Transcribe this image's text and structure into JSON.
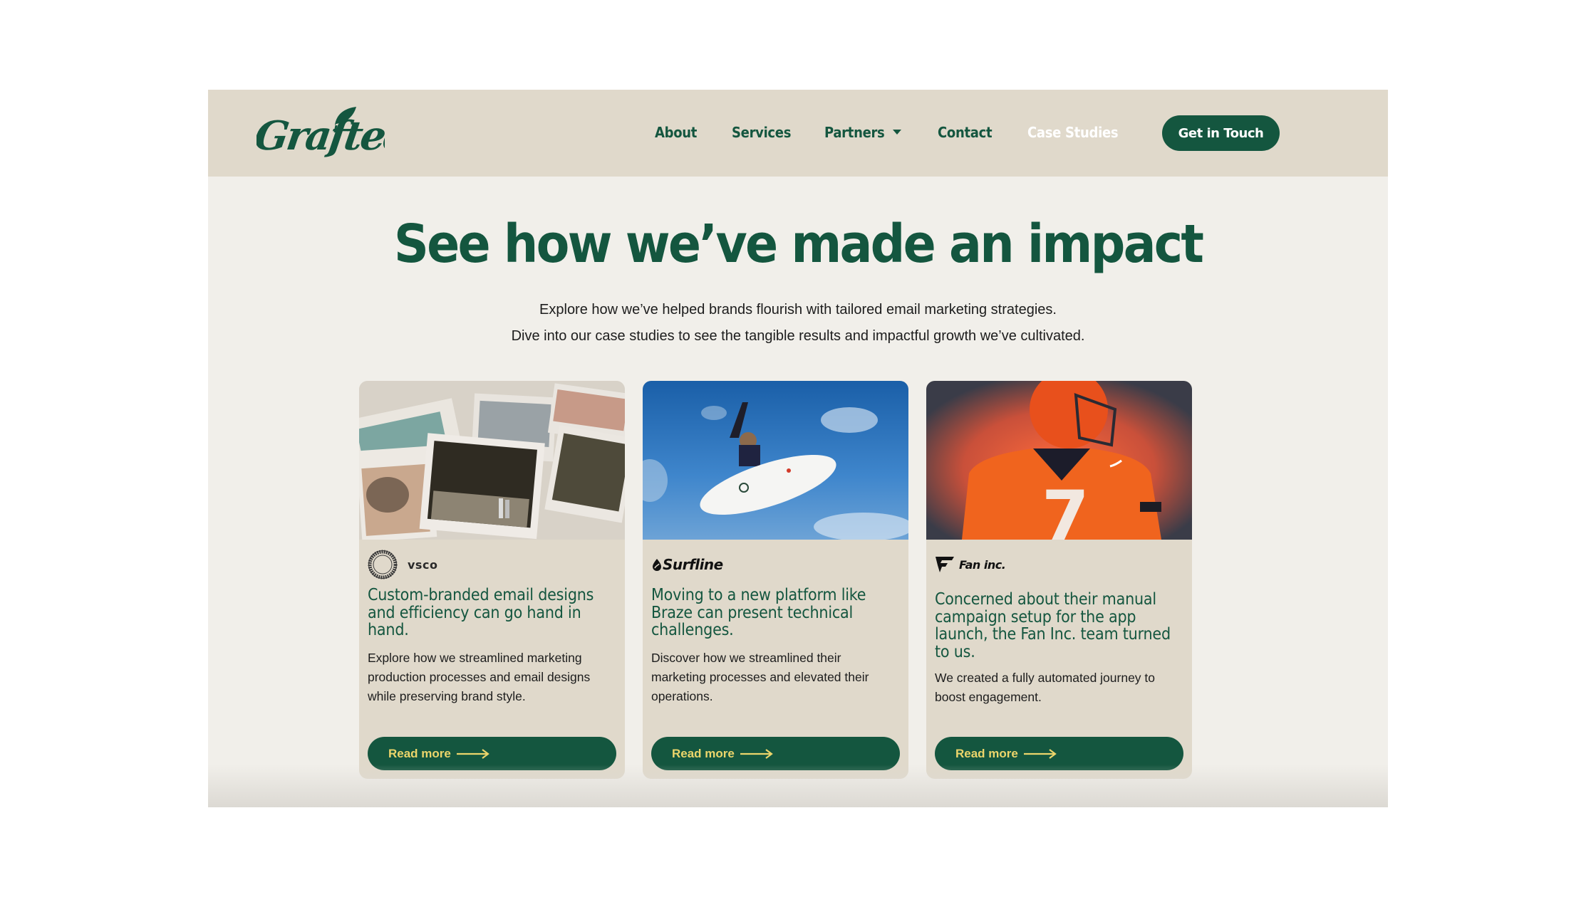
{
  "brand": {
    "name": "Grafted",
    "primary_color": "#14563f",
    "header_bg": "#e0d9cb",
    "page_bg": "#f1efea",
    "accent_text": "#ecd56b"
  },
  "nav": {
    "items": [
      {
        "label": "About",
        "active": false
      },
      {
        "label": "Services",
        "active": false
      },
      {
        "label": "Partners",
        "active": false,
        "has_dropdown": true
      },
      {
        "label": "Contact",
        "active": false
      },
      {
        "label": "Case Studies",
        "active": true
      }
    ],
    "cta_label": "Get in Touch"
  },
  "hero": {
    "title": "See how we’ve made an impact",
    "subtitle_line1": "Explore how we’ve helped brands flourish with tailored email marketing strategies.",
    "subtitle_line2": "Dive into our case studies to see the tangible results and impactful growth we’ve cultivated."
  },
  "cards": [
    {
      "image": "scattered-polaroid-photos",
      "client_logo": "vsco-logo",
      "client_name": "vsco",
      "title": "Custom-branded email designs and efficiency can go hand in hand.",
      "description": "Explore how we streamlined marketing production processes and email designs while preserving brand style.",
      "button_label": "Read more"
    },
    {
      "image": "surfer-aerial-blue-sky",
      "client_logo": "surfline-logo",
      "client_name": "Surfline",
      "title": "Moving to a new platform like Braze can present technical challenges.",
      "description": "Discover how we streamlined their marketing processes and elevated their operations.",
      "button_label": "Read more"
    },
    {
      "image": "football-player-orange-jersey-7",
      "client_logo": "fan-inc-logo",
      "client_name": "Fan inc.",
      "title": "Concerned about their manual campaign setup for the app launch, the Fan Inc. team turned to us.",
      "description": "We created a fully automated journey to boost engagement.",
      "button_label": "Read more"
    }
  ]
}
